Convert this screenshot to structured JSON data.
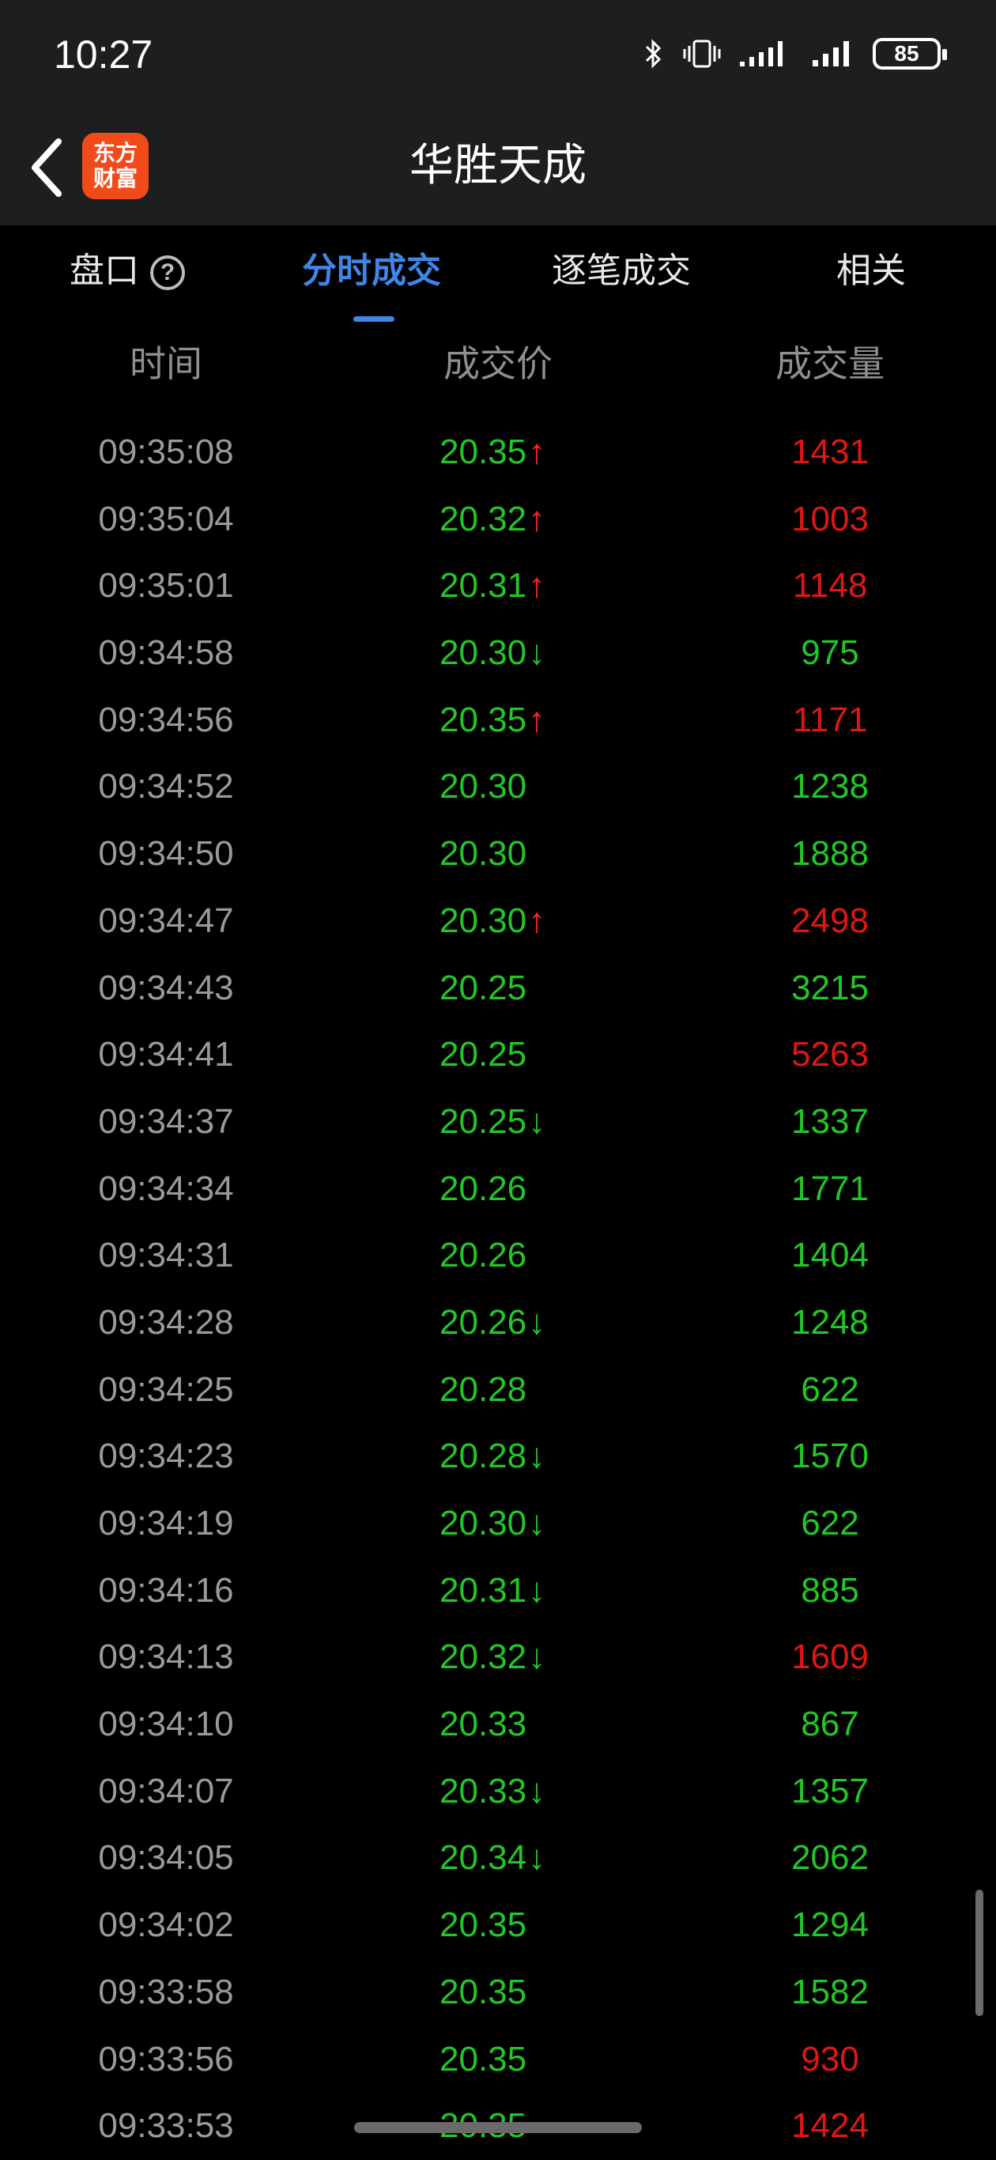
{
  "status": {
    "time": "10:27",
    "battery": "85"
  },
  "nav": {
    "title": "华胜天成",
    "logo_line1": "东方",
    "logo_line2": "财富"
  },
  "tabs": [
    {
      "label": "盘口"
    },
    {
      "label": "分时成交"
    },
    {
      "label": "逐笔成交"
    },
    {
      "label": "相关"
    }
  ],
  "help_glyph": "?",
  "columns": {
    "time": "时间",
    "price": "成交价",
    "volume": "成交量"
  },
  "colors": {
    "up": "#ff2323",
    "down": "#22c628",
    "accent": "#3f86e6",
    "background": "#000000"
  },
  "rows": [
    {
      "time": "09:35:08",
      "price": "20.35",
      "arrow": "↑",
      "dir": "up",
      "volume": "1431",
      "vol_color": "red"
    },
    {
      "time": "09:35:04",
      "price": "20.32",
      "arrow": "↑",
      "dir": "up",
      "volume": "1003",
      "vol_color": "red"
    },
    {
      "time": "09:35:01",
      "price": "20.31",
      "arrow": "↑",
      "dir": "up",
      "volume": "1148",
      "vol_color": "red"
    },
    {
      "time": "09:34:58",
      "price": "20.30",
      "arrow": "↓",
      "dir": "down",
      "volume": "975",
      "vol_color": "green"
    },
    {
      "time": "09:34:56",
      "price": "20.35",
      "arrow": "↑",
      "dir": "up",
      "volume": "1171",
      "vol_color": "red"
    },
    {
      "time": "09:34:52",
      "price": "20.30",
      "arrow": "",
      "dir": "",
      "volume": "1238",
      "vol_color": "green"
    },
    {
      "time": "09:34:50",
      "price": "20.30",
      "arrow": "",
      "dir": "",
      "volume": "1888",
      "vol_color": "green"
    },
    {
      "time": "09:34:47",
      "price": "20.30",
      "arrow": "↑",
      "dir": "up",
      "volume": "2498",
      "vol_color": "red"
    },
    {
      "time": "09:34:43",
      "price": "20.25",
      "arrow": "",
      "dir": "",
      "volume": "3215",
      "vol_color": "green"
    },
    {
      "time": "09:34:41",
      "price": "20.25",
      "arrow": "",
      "dir": "",
      "volume": "5263",
      "vol_color": "red"
    },
    {
      "time": "09:34:37",
      "price": "20.25",
      "arrow": "↓",
      "dir": "down",
      "volume": "1337",
      "vol_color": "green"
    },
    {
      "time": "09:34:34",
      "price": "20.26",
      "arrow": "",
      "dir": "",
      "volume": "1771",
      "vol_color": "green"
    },
    {
      "time": "09:34:31",
      "price": "20.26",
      "arrow": "",
      "dir": "",
      "volume": "1404",
      "vol_color": "green"
    },
    {
      "time": "09:34:28",
      "price": "20.26",
      "arrow": "↓",
      "dir": "down",
      "volume": "1248",
      "vol_color": "green"
    },
    {
      "time": "09:34:25",
      "price": "20.28",
      "arrow": "",
      "dir": "",
      "volume": "622",
      "vol_color": "green"
    },
    {
      "time": "09:34:23",
      "price": "20.28",
      "arrow": "↓",
      "dir": "down",
      "volume": "1570",
      "vol_color": "green"
    },
    {
      "time": "09:34:19",
      "price": "20.30",
      "arrow": "↓",
      "dir": "down",
      "volume": "622",
      "vol_color": "green"
    },
    {
      "time": "09:34:16",
      "price": "20.31",
      "arrow": "↓",
      "dir": "down",
      "volume": "885",
      "vol_color": "green"
    },
    {
      "time": "09:34:13",
      "price": "20.32",
      "arrow": "↓",
      "dir": "down",
      "volume": "1609",
      "vol_color": "red"
    },
    {
      "time": "09:34:10",
      "price": "20.33",
      "arrow": "",
      "dir": "",
      "volume": "867",
      "vol_color": "green"
    },
    {
      "time": "09:34:07",
      "price": "20.33",
      "arrow": "↓",
      "dir": "down",
      "volume": "1357",
      "vol_color": "green"
    },
    {
      "time": "09:34:05",
      "price": "20.34",
      "arrow": "↓",
      "dir": "down",
      "volume": "2062",
      "vol_color": "green"
    },
    {
      "time": "09:34:02",
      "price": "20.35",
      "arrow": "",
      "dir": "",
      "volume": "1294",
      "vol_color": "green"
    },
    {
      "time": "09:33:58",
      "price": "20.35",
      "arrow": "",
      "dir": "",
      "volume": "1582",
      "vol_color": "green"
    },
    {
      "time": "09:33:56",
      "price": "20.35",
      "arrow": "",
      "dir": "",
      "volume": "930",
      "vol_color": "red"
    },
    {
      "time": "09:33:53",
      "price": "20.35",
      "arrow": "",
      "dir": "",
      "volume": "1424",
      "vol_color": "red"
    }
  ]
}
